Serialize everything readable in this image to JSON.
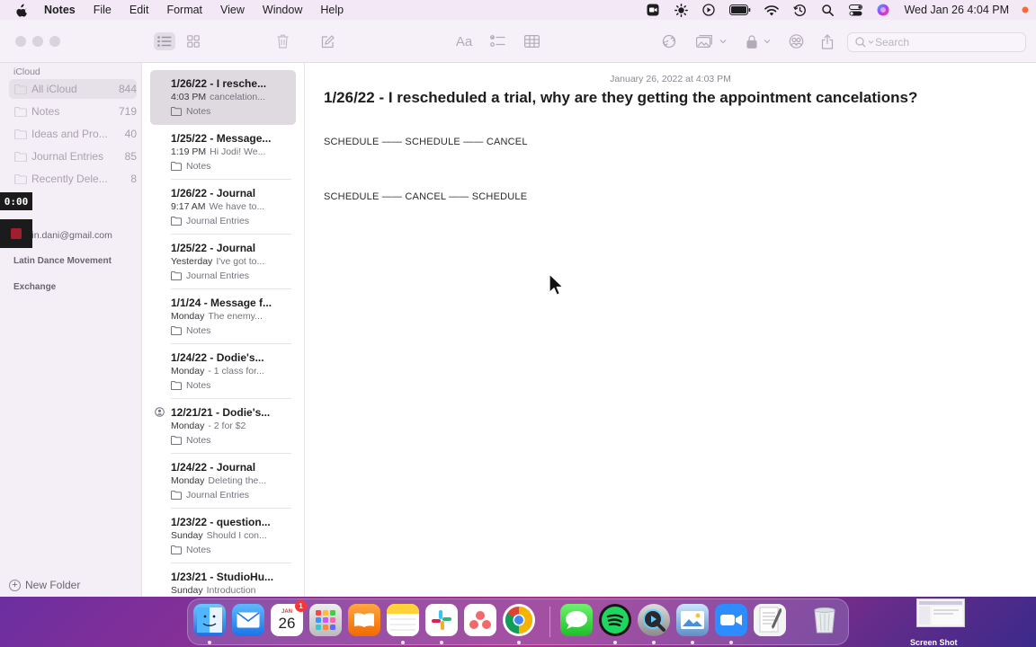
{
  "menubar": {
    "app_name": "Notes",
    "menus": [
      "File",
      "Edit",
      "Format",
      "View",
      "Window",
      "Help"
    ],
    "clock": "Wed Jan 26  4:04 PM",
    "status_icons": [
      "screen-record-icon",
      "brightness-icon",
      "play-icon",
      "battery-icon",
      "wifi-icon",
      "time-machine-icon",
      "spotlight-search-icon",
      "control-center-icon",
      "siri-icon"
    ]
  },
  "toolbar": {
    "search_placeholder": "Search",
    "format_label": "Aa"
  },
  "sidebar": {
    "section_icloud": "iCloud",
    "folders": [
      {
        "name": "All iCloud",
        "count": "844"
      },
      {
        "name": "Notes",
        "count": "719"
      },
      {
        "name": "Ideas and Pro...",
        "count": "40"
      },
      {
        "name": "Journal Entries",
        "count": "85"
      },
      {
        "name": "Recently Dele...",
        "count": "8"
      }
    ],
    "accounts": [
      "hervin.dani@gmail.com",
      "Latin Dance Movement",
      "Exchange"
    ],
    "new_folder_label": "New Folder",
    "recording_time": "0:00"
  },
  "notes": [
    {
      "title": "1/26/22 - I resche...",
      "time": "4:03 PM",
      "preview": "cancelation...",
      "folder": "Notes"
    },
    {
      "title": "1/25/22 - Message...",
      "time": "1:19 PM",
      "preview": "Hi Jodi! We...",
      "folder": "Notes"
    },
    {
      "title": "1/26/22 - Journal",
      "time": "9:17 AM",
      "preview": "We have to...",
      "folder": "Journal Entries"
    },
    {
      "title": "1/25/22 - Journal",
      "time": "Yesterday",
      "preview": "I've got to...",
      "folder": "Journal Entries"
    },
    {
      "title": "1/1/24 - Message f...",
      "time": "Monday",
      "preview": "The enemy...",
      "folder": "Notes"
    },
    {
      "title": "1/24/22 - Dodie's...",
      "time": "Monday",
      "preview": "- 1 class for...",
      "folder": "Notes"
    },
    {
      "title": "12/21/21 - Dodie's...",
      "time": "Monday",
      "preview": "- 2 for $2",
      "folder": "Notes"
    },
    {
      "title": "1/24/22 - Journal",
      "time": "Monday",
      "preview": "Deleting the...",
      "folder": "Journal Entries"
    },
    {
      "title": "1/23/22 - question...",
      "time": "Sunday",
      "preview": "Should I con...",
      "folder": "Notes"
    },
    {
      "title": "1/23/21 - StudioHu...",
      "time": "Sunday",
      "preview": "Introduction",
      "folder": ""
    }
  ],
  "editor": {
    "date": "January 26, 2022 at 4:03 PM",
    "title": "1/26/22 - I rescheduled a trial, why are they getting the appointment cancelations?",
    "lines": [
      "SCHEDULE —— SCHEDULE —— CANCEL",
      "SCHEDULE —— CANCEL —— SCHEDULE"
    ]
  },
  "dock": {
    "calendar_day": "26",
    "calendar_month": "JAN",
    "calendar_badge": "1",
    "apps": [
      "finder",
      "mail",
      "calendar",
      "launchpad",
      "books",
      "notes",
      "slack",
      "asana",
      "chrome",
      "messages",
      "spotify",
      "quicktime",
      "preview",
      "zoom",
      "textedit",
      "trash"
    ]
  },
  "desktop": {
    "thumbnail_label": "Screen Shot"
  }
}
